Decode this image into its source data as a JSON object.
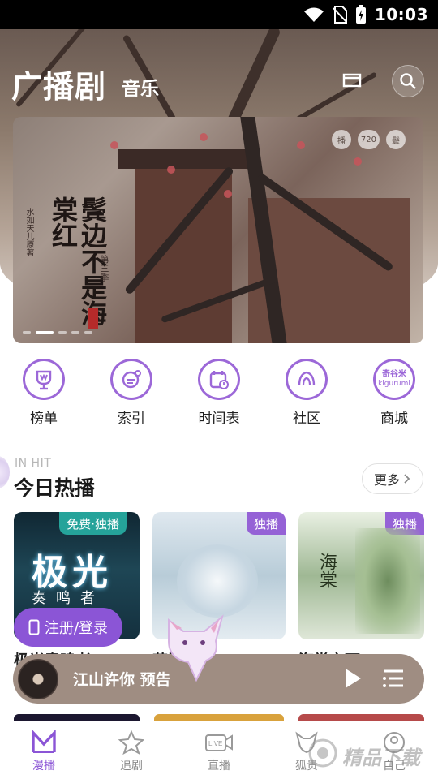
{
  "status_bar": {
    "time": "10:03"
  },
  "header": {
    "tab_active": "广播剧",
    "tab_other": "音乐"
  },
  "banner": {
    "title": "鬓边不是海棠红",
    "season": "第三季",
    "subtitle": "水如天儿原著",
    "badge_platform": "播",
    "badge_code": "720",
    "badge_seal": "鬓"
  },
  "quick_nav": [
    {
      "label": "榜单",
      "icon": "trophy-icon"
    },
    {
      "label": "索引",
      "icon": "index-icon"
    },
    {
      "label": "时间表",
      "icon": "calendar-clock-icon"
    },
    {
      "label": "社区",
      "icon": "community-icon"
    },
    {
      "label": "商城",
      "icon": "kigurumi-shop-icon",
      "brand_top": "奇谷米",
      "brand_bottom": "kigurumi"
    }
  ],
  "section": {
    "kicker": "IN HIT",
    "title": "今日热播",
    "more_label": "更多"
  },
  "cards": [
    {
      "badge": "免费·独播",
      "title": "极光",
      "sub": "奏鸣者",
      "caption": "极光奏鸣者"
    },
    {
      "badge": "独播",
      "caption": "花间"
    },
    {
      "badge": "独播",
      "caption": "海棠之下",
      "art_text": "海棠"
    }
  ],
  "login": {
    "label": "注册/登录"
  },
  "player": {
    "title": "江山许你 预告"
  },
  "tab_bar": [
    {
      "label": "漫播",
      "icon": "home-m-icon",
      "active": true
    },
    {
      "label": "追剧",
      "icon": "star-icon",
      "active": false
    },
    {
      "label": "直播",
      "icon": "live-icon",
      "active": false
    },
    {
      "label": "狐贵",
      "icon": "fox-icon",
      "active": false
    },
    {
      "label": "自己",
      "icon": "profile-icon",
      "active": false
    }
  ],
  "watermark": {
    "text": "精品下载"
  },
  "colors": {
    "accent": "#8b55d6",
    "badge_teal": "#25a39a",
    "player": "#9f8d82"
  }
}
